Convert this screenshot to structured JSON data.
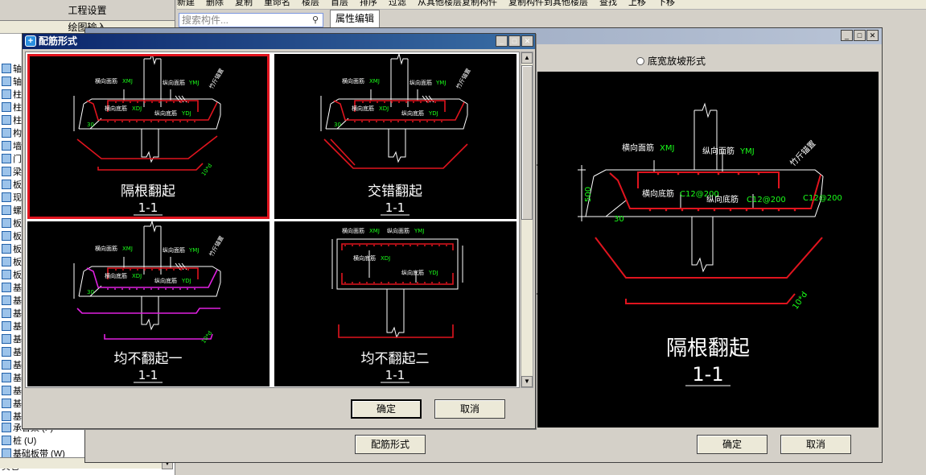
{
  "app": {
    "project_settings": "工程设置",
    "drawing_input": "绘图输入",
    "toolbar_items": [
      "新建",
      "删除",
      "复制",
      "重命名",
      "楼层",
      "首层",
      "排序",
      "过滤",
      "从其他楼层复制构件",
      "复制构件到其他楼层",
      "查找",
      "上移",
      "下移"
    ],
    "search_placeholder": "搜索构件...",
    "property_tab": "属性编辑",
    "tree_items": [
      {
        "label": "轴网",
        "icon": "grid-icon"
      },
      {
        "label": "轴线",
        "icon": "axis-icon"
      },
      {
        "label": "柱",
        "icon": "column-icon"
      },
      {
        "label": "柱",
        "icon": "column-icon"
      },
      {
        "label": "柱",
        "icon": "column-icon"
      },
      {
        "label": "构",
        "icon": "component-icon"
      },
      {
        "label": "墙",
        "icon": "wall-icon"
      },
      {
        "label": "门窗",
        "icon": "door-icon"
      },
      {
        "label": "梁",
        "icon": "beam-icon"
      },
      {
        "label": "板",
        "icon": "slab-icon"
      },
      {
        "label": "现",
        "icon": "slab-icon"
      },
      {
        "label": "螺",
        "icon": "stair-icon"
      },
      {
        "label": "板",
        "icon": "slab-icon"
      },
      {
        "label": "板",
        "icon": "slab-icon"
      },
      {
        "label": "板",
        "icon": "slab-icon"
      },
      {
        "label": "板",
        "icon": "slab-icon"
      },
      {
        "label": "板",
        "icon": "slab-icon"
      },
      {
        "label": "基础",
        "icon": "foundation-icon"
      },
      {
        "label": "基",
        "icon": "foundation-icon"
      },
      {
        "label": "基",
        "icon": "foundation-icon"
      },
      {
        "label": "基",
        "icon": "foundation-icon"
      },
      {
        "label": "基",
        "icon": "foundation-icon"
      },
      {
        "label": "基",
        "icon": "foundation-icon"
      },
      {
        "label": "基",
        "icon": "foundation-icon"
      },
      {
        "label": "基",
        "icon": "foundation-icon"
      },
      {
        "label": "基",
        "icon": "foundation-icon"
      },
      {
        "label": "基",
        "icon": "foundation-icon"
      },
      {
        "label": "基",
        "icon": "foundation-icon"
      }
    ],
    "tree_bottom": [
      "承台梁 (F)",
      "桩 (U)",
      "基础板带 (W)",
      "其它"
    ]
  },
  "back_dialog": {
    "radio_label": "底宽放坡形式",
    "config_button": "配筋形式",
    "ok_button": "确定",
    "cancel_button": "取消",
    "preview": {
      "title": "隔根翻起",
      "section": "1-1",
      "dim_height": "500",
      "dim_slope": "30",
      "dim_side": "10*d",
      "labels": [
        "横向面筋",
        "XMJ",
        "纵向面筋",
        "YMJ",
        "横向底筋",
        "C12@200",
        "纵向底筋",
        "C12@200",
        "C12@200",
        "竹斤锚置"
      ]
    },
    "section_marker": "1"
  },
  "front_dialog": {
    "title": "配筋形式",
    "ok_button": "确定",
    "cancel_button": "取消",
    "options": [
      {
        "title": "隔根翻起",
        "section": "1-1",
        "selected": true
      },
      {
        "title": "交错翻起",
        "section": "1-1",
        "selected": false
      },
      {
        "title": "均不翻起一",
        "section": "1-1",
        "selected": false
      },
      {
        "title": "均不翻起二",
        "section": "1-1",
        "selected": false
      }
    ],
    "card_labels": {
      "top_transverse": "横向面筋",
      "top_longitudinal": "纵向面筋",
      "bottom_transverse": "横向底筋",
      "bottom_longitudinal": "纵向底筋",
      "code_xmj": "XMJ",
      "code_ymj": "YMJ",
      "code_xdj": "XDJ",
      "code_ydj": "YDJ",
      "slope": "30",
      "side_dim": "10*d",
      "bar_note": "竹斤锚置"
    }
  },
  "colors": {
    "cad_background": "#000000",
    "cad_red": "#e0141e",
    "cad_white": "#ffffff",
    "cad_green": "#19ff19",
    "cad_magenta": "#e020e0",
    "title_bar": "#0a246a",
    "window_face": "#d4d0c8"
  }
}
